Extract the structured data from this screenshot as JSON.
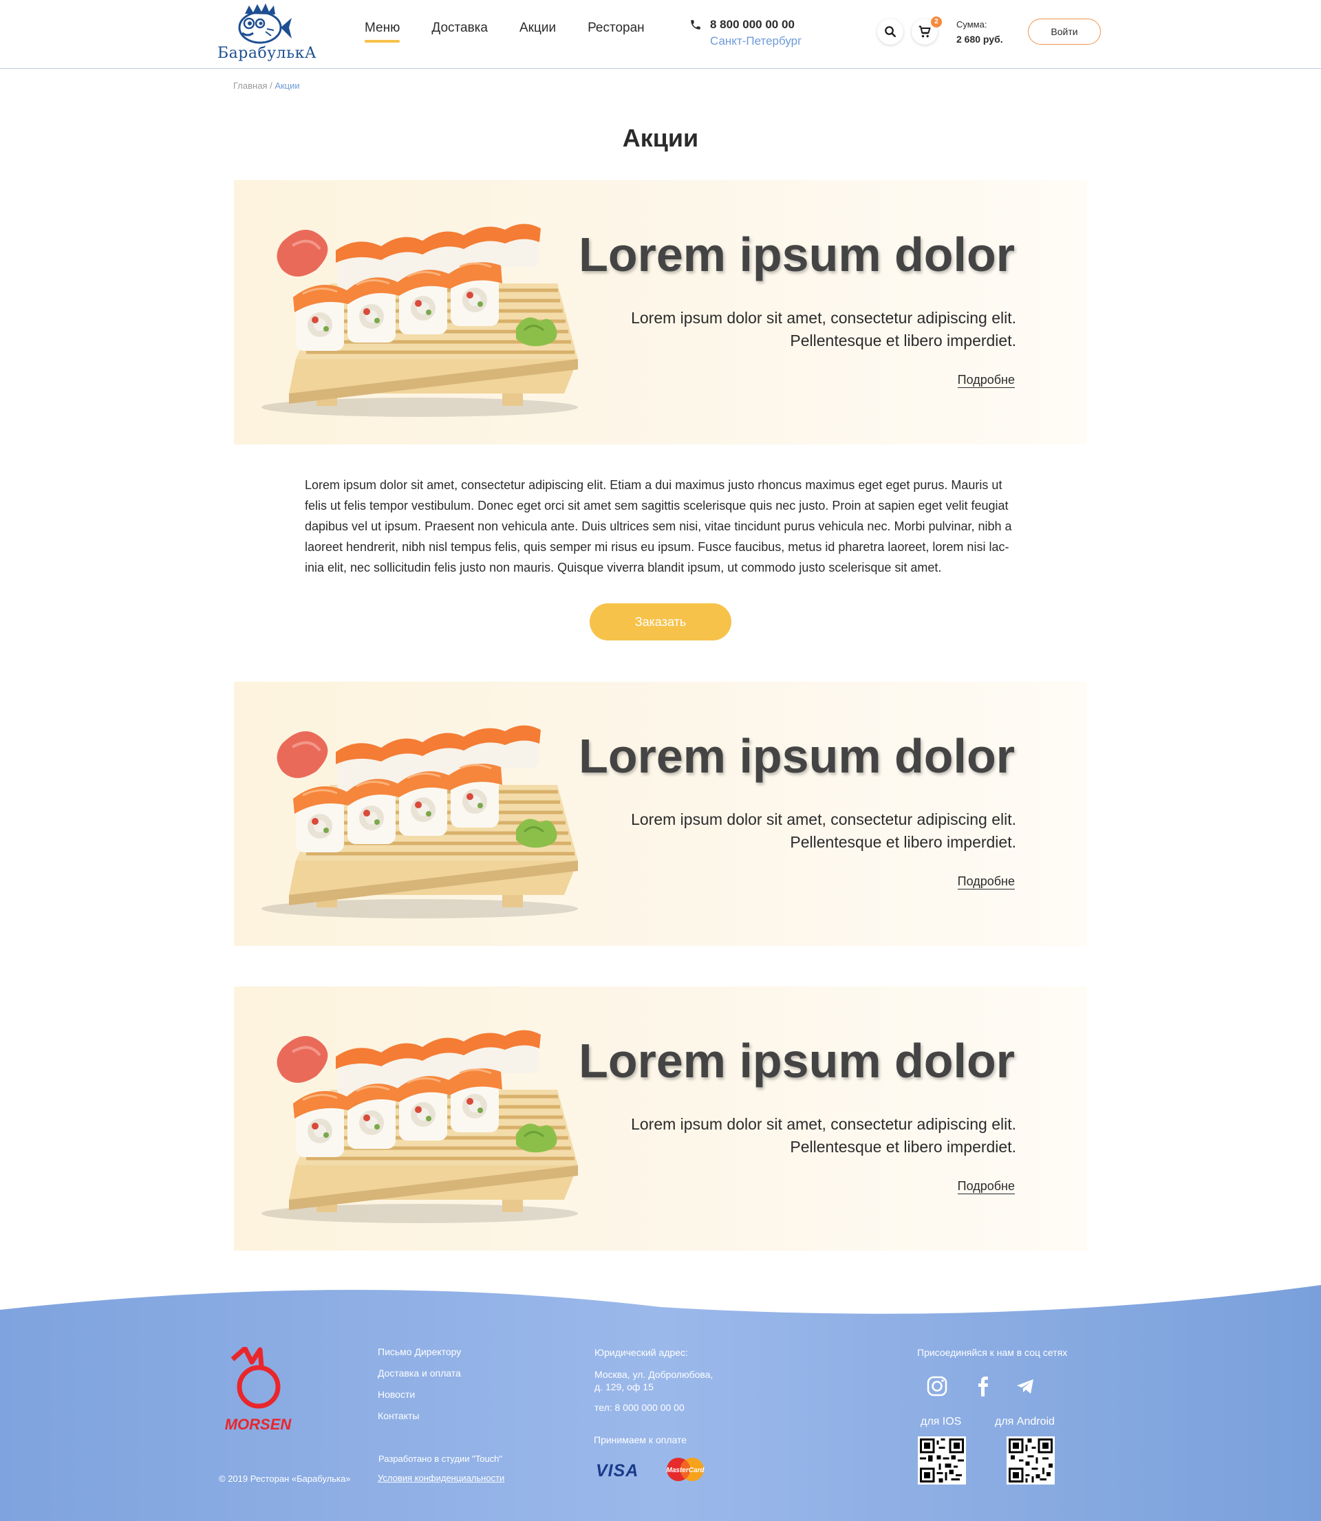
{
  "header": {
    "logo_text": "БарабулькА",
    "nav": [
      {
        "label": "Меню",
        "active": true
      },
      {
        "label": "Доставка",
        "active": false
      },
      {
        "label": "Акции",
        "active": false
      },
      {
        "label": "Ресторан",
        "active": false
      }
    ],
    "phone": "8 800 000 00 00",
    "city": "Санкт-Петербург",
    "cart_count": "2",
    "sum_label": "Сумма:",
    "sum_value": "2 680 руб.",
    "login": "Войти",
    "icons": {
      "search": "search-icon",
      "cart": "cart-icon",
      "phone": "phone-icon"
    }
  },
  "breadcrumb": {
    "home": "Главная",
    "separator": " / ",
    "current": "Акции"
  },
  "page_title": "Акции",
  "promos": [
    {
      "heading": "Lorem ipsum dolor",
      "text_line1": "Lorem ipsum dolor sit amet, consectetur adipiscing elit.",
      "text_line2": "Pellentesque et libero imperdiet.",
      "more": "Подробне"
    },
    {
      "heading": "Lorem ipsum dolor",
      "text_line1": "Lorem ipsum dolor sit amet, consectetur adipiscing elit.",
      "text_line2": "Pellentesque et libero imperdiet.",
      "more": "Подробне"
    },
    {
      "heading": "Lorem ipsum dolor",
      "text_line1": "Lorem ipsum dolor sit amet, consectetur adipiscing elit.",
      "text_line2": "Pellentesque et libero imperdiet.",
      "more": "Подробне"
    }
  ],
  "description": "Lorem ipsum dolor sit amet, consectetur adipiscing elit. Etiam a dui maximus justo rhoncus maximus eget eget purus. Mauris ut felis ut felis tempor vestibulum. Donec eget orci sit amet sem sagittis scelerisque quis nec justo. Proin at sapien eget velit feugiat dapibus vel ut ipsum. Praesent non vehicula ante. Duis ultrices sem nisi, vitae tincidunt purus vehicula nec. Morbi pulvinar, nibh a laoreet hendrerit, nibh nisl tempus felis, quis semper mi risus eu ipsum. Fusce faucibus, metus id pharetra laoreet, lorem nisi lac-inia elit, nec sollicitudin felis justo non mauris. Quisque viverra blandit ipsum, ut commodo justo scelerisque sit amet.",
  "order_button": "Заказать",
  "footer": {
    "logo_text": "MORSEN",
    "copyright": "© 2019 Ресторан «Барабулька»",
    "links": [
      "Письмо Директору",
      "Доставка и оплата",
      "Новости",
      "Контакты"
    ],
    "studio": "Разработано в студии \"Touch\"",
    "privacy": "Условия конфиденциальности",
    "legal_title": "Юридический адрес:",
    "address_line1": "Москва, ул. Добролюбова,",
    "address_line2": "д. 129, оф 15",
    "phone": "тел: 8 000 000 00 00",
    "payment_label": "Принимаем к оплате",
    "visa": "VISA",
    "mastercard": "MasterCard",
    "social_label": "Присоединяйся к нам в соц сетях",
    "ios_label": "для IOS",
    "android_label": "для Android",
    "colors": {
      "wave": "#8fb0e4",
      "accent": "#f6c24a",
      "link_blue": "#6e9ad8"
    }
  }
}
